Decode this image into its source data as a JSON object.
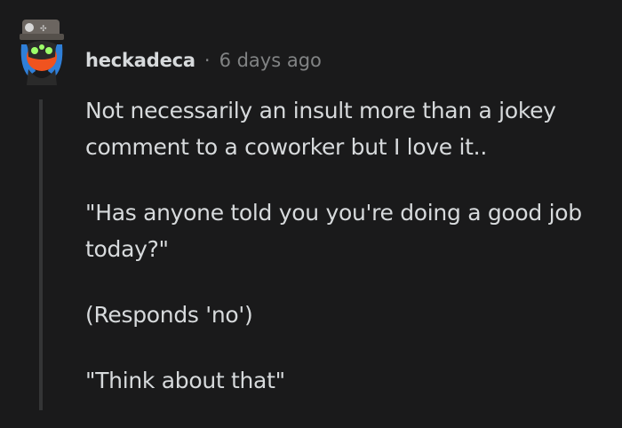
{
  "comment": {
    "author": "heckadeca",
    "separator": "·",
    "timestamp": "6 days ago",
    "paragraphs": [
      "Not necessarily an insult more than a jokey comment to a coworker but I love it..",
      "\"Has anyone told you you're doing a good job today?\"",
      "(Responds 'no')",
      "\"Think about that\""
    ],
    "avatar_icon": "snoo-avatar-icon"
  },
  "colors": {
    "background": "#1a1a1b",
    "text": "#d7dadc",
    "meta": "#818384",
    "thread_line": "#343536"
  }
}
